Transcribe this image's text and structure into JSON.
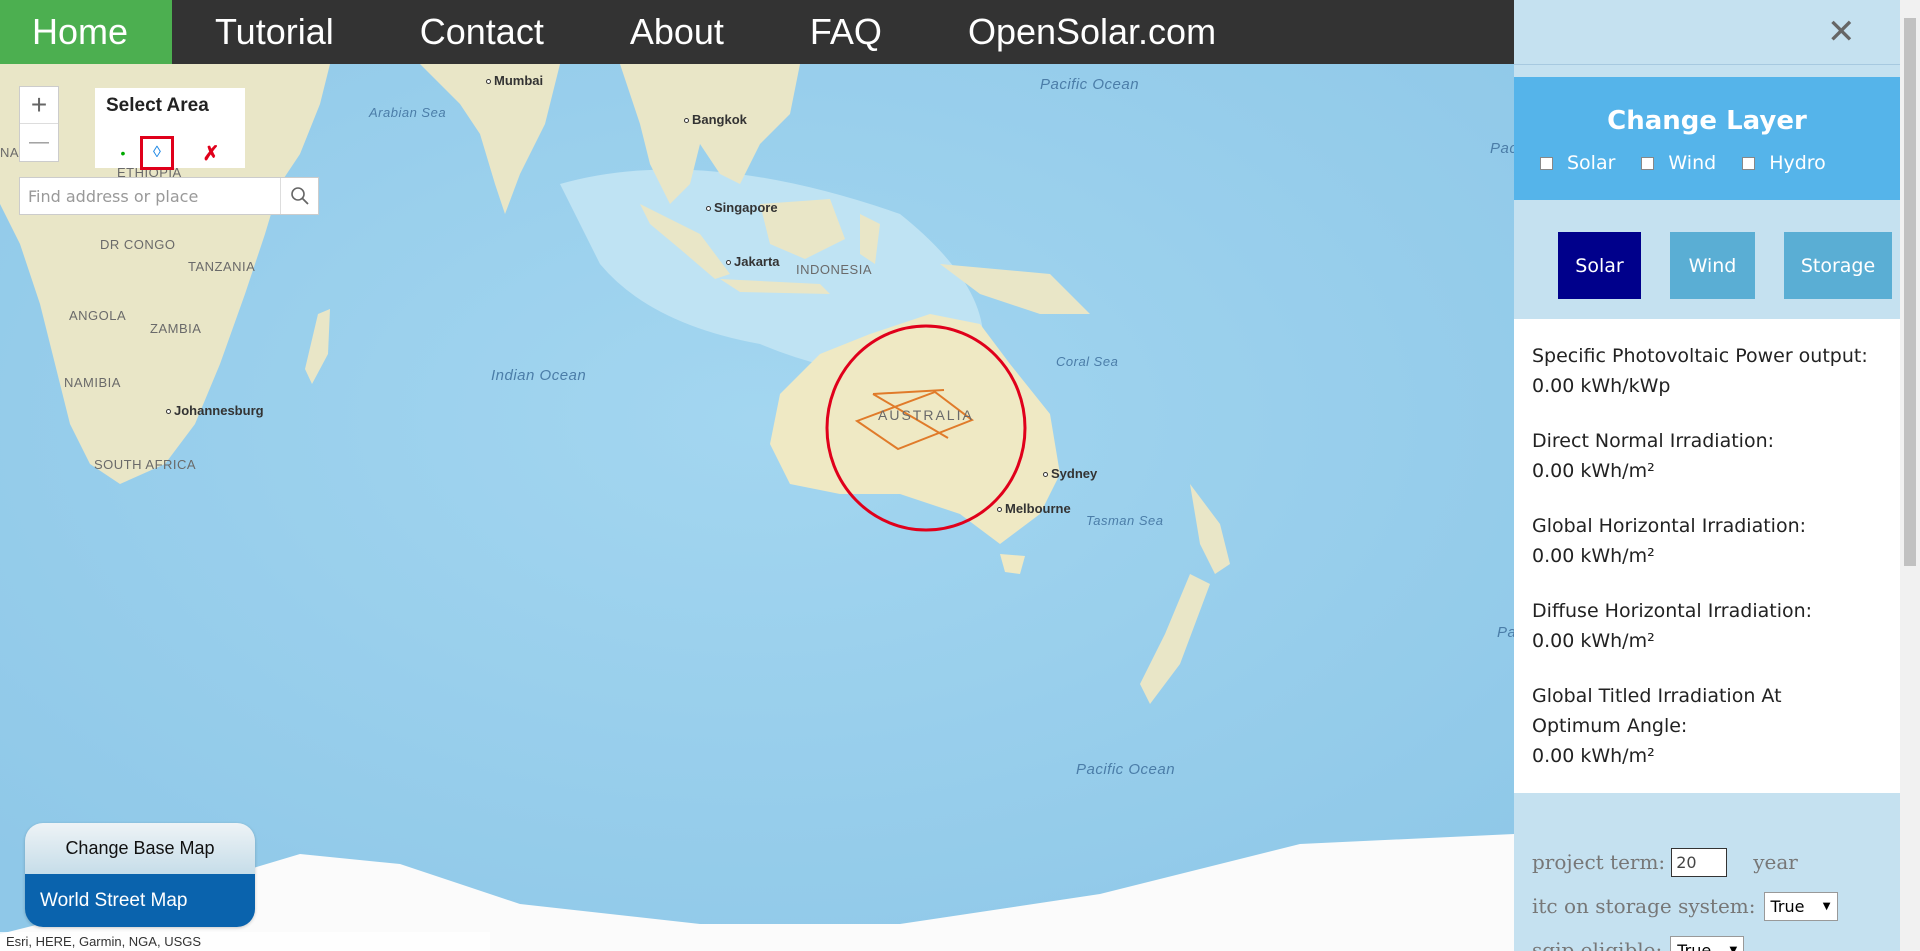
{
  "nav": {
    "items": [
      {
        "label": "Home",
        "active": true
      },
      {
        "label": "Tutorial"
      },
      {
        "label": "Contact"
      },
      {
        "label": "About"
      },
      {
        "label": "FAQ"
      },
      {
        "label": "OpenSolar.com"
      }
    ],
    "active_color": "#4caf50",
    "bg_color": "#333333"
  },
  "map": {
    "zoom": {
      "in": "+",
      "out": "—"
    },
    "select_area": {
      "title": "Select Area",
      "point_icon": "•",
      "polygon_icon": "◊",
      "clear_icon": "✗"
    },
    "search": {
      "placeholder": "Find address or place",
      "button_icon": "search-icon"
    },
    "basemap": {
      "title": "Change Base Map",
      "selected": "World Street Map"
    },
    "attribution": "Esri, HERE, Garmin, NGA, USGS",
    "labels": {
      "oceans": [
        "Pacific Ocean",
        "Arabian Sea",
        "Indian Ocean",
        "Coral Sea",
        "Tasman Sea",
        "Pacific Ocean",
        "Pac",
        "Pa"
      ],
      "countries": [
        "ETHIOPIA",
        "DR CONGO",
        "TANZANIA",
        "ANGOLA",
        "ZAMBIA",
        "NAMIBIA",
        "SOUTH AFRICA",
        "INDONESIA",
        "AUSTRALIA",
        "NA"
      ],
      "cities": [
        "Mumbai",
        "Bangkok",
        "Singapore",
        "Jakarta",
        "Johannesburg",
        "Sydney",
        "Melbourne"
      ]
    }
  },
  "panel": {
    "close_icon": "✕",
    "layer": {
      "title": "Change Layer",
      "options": [
        "Solar",
        "Wind",
        "Hydro"
      ]
    },
    "tabs": [
      "Solar",
      "Wind",
      "Storage"
    ],
    "metrics": [
      {
        "label": "Specific Photovoltaic Power output:",
        "value": "0.00 kWh/kWp"
      },
      {
        "label": "Direct Normal Irradiation:",
        "value": "0.00 kWh/m²"
      },
      {
        "label": "Global Horizontal Irradiation:",
        "value": "0.00 kWh/m²"
      },
      {
        "label": "Diffuse Horizontal Irradiation:",
        "value": "0.00 kWh/m²"
      },
      {
        "label": "Global Titled Irradiation At Optimum Angle:",
        "value": "0.00 kWh/m²"
      }
    ],
    "form": {
      "project_term_label": "project term:",
      "project_term_value": "20",
      "project_term_unit": "year",
      "itc_label": "itc on storage system:",
      "itc_value": "True",
      "sgip_label": "sgip eligible:",
      "sgip_value": "True"
    },
    "colors": {
      "header_bg": "#55b4ea",
      "active_tab": "#00008b",
      "inactive_tab": "#5aaed4",
      "panel_bg": "#c5e1f0"
    }
  }
}
